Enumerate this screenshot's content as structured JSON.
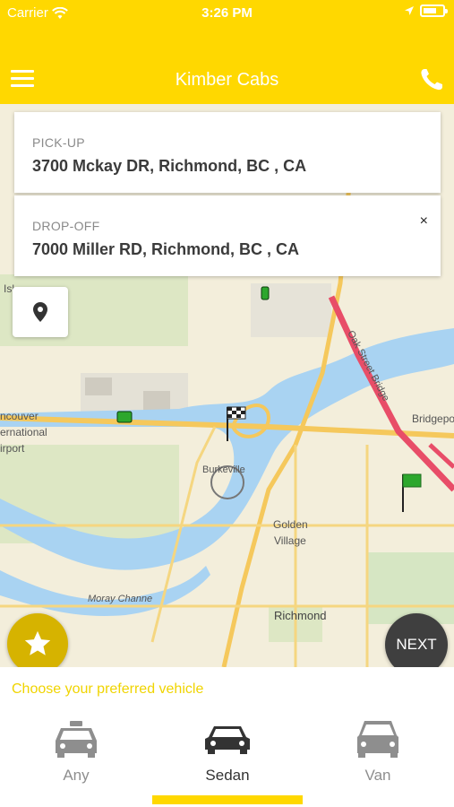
{
  "status_bar": {
    "carrier": "Carrier",
    "time": "3:26 PM"
  },
  "header": {
    "title": "Kimber Cabs"
  },
  "pickup": {
    "label": "PICK-UP",
    "address": "3700 Mckay DR, Richmond, BC , CA"
  },
  "dropoff": {
    "label": "DROP-OFF",
    "address": "7000 Miller RD, Richmond, BC , CA",
    "clear_label": "×"
  },
  "map": {
    "labels": [
      "Oak Street Bridge",
      "Bridgepo",
      "ncouver",
      "ernational",
      "irport",
      "Burkeville",
      "Golden",
      "Village",
      "Moray Channe",
      "Richmond",
      "Isl"
    ]
  },
  "next_label": "NEXT",
  "vehicle_prompt": "Choose your preferred vehicle",
  "vehicles": [
    {
      "label": "Any",
      "selected": false
    },
    {
      "label": "Sedan",
      "selected": true
    },
    {
      "label": "Van",
      "selected": false
    }
  ],
  "colors": {
    "brand_yellow": "#ffd800",
    "pickup_green": "#2da72d",
    "dark_button": "#3f3f3f",
    "fav_button": "#d6b300"
  }
}
